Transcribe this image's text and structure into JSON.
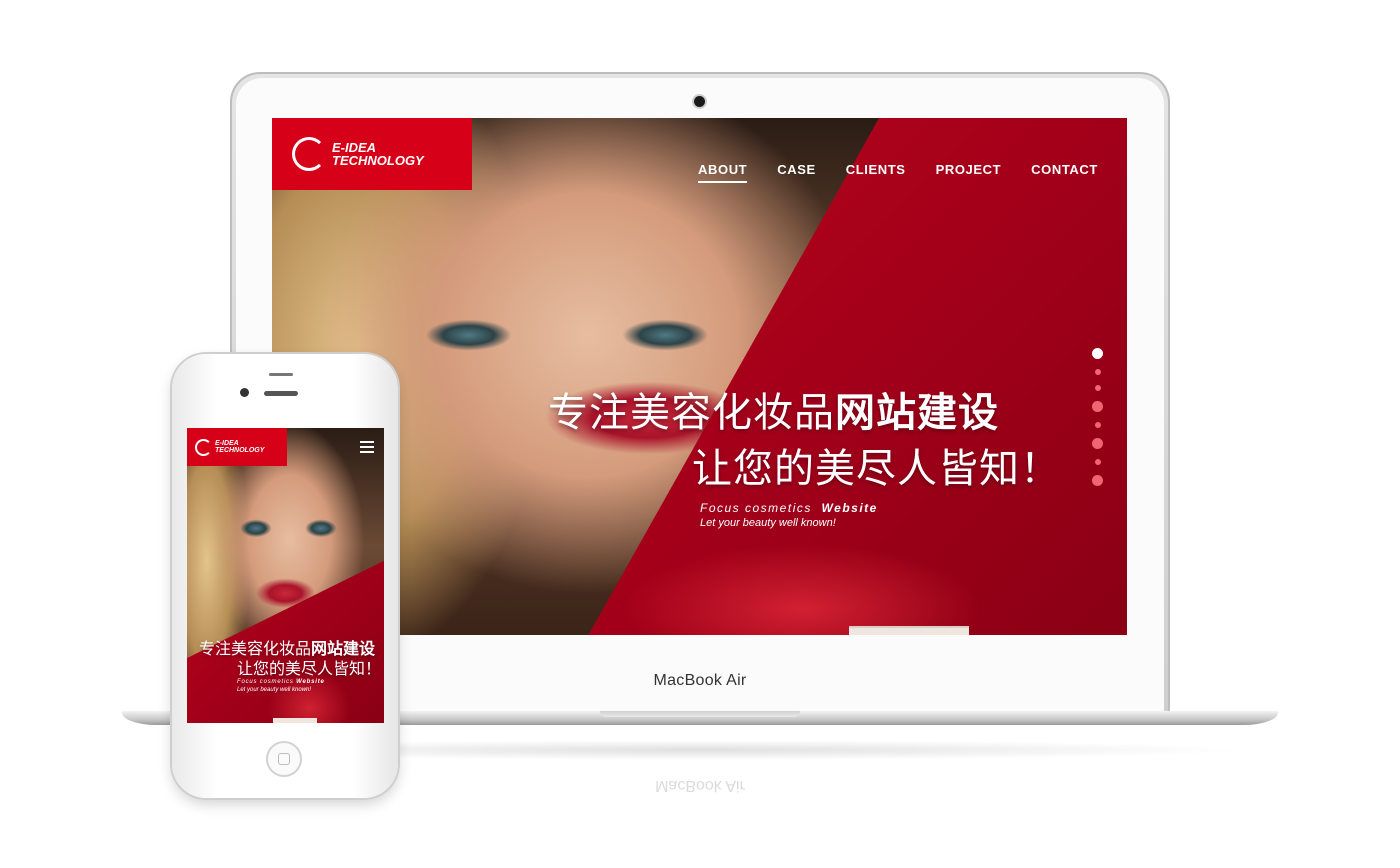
{
  "site": {
    "logo": {
      "line1": "E-IDEA",
      "line2": "TECHNOLOGY"
    },
    "nav": [
      {
        "label": "ABOUT",
        "active": true
      },
      {
        "label": "CASE",
        "active": false
      },
      {
        "label": "CLIENTS",
        "active": false
      },
      {
        "label": "PROJECT",
        "active": false
      },
      {
        "label": "CONTACT",
        "active": false
      }
    ],
    "headline_plain": "专注美容化妆品",
    "headline_bold": "网站建设",
    "headline_line2": "让您的美尽人皆知！",
    "sub_line1_a": "Focus  cosmetics",
    "sub_line1_b": "Website",
    "sub_line2": "Let your beauty well known!",
    "slider_dots": 8,
    "slider_active_index": 0
  },
  "device": {
    "laptop_brand": "MacBook Air"
  },
  "colors": {
    "brand_red": "#d60019",
    "background": "#ffffff"
  },
  "icons": {
    "menu": "hamburger-menu-icon",
    "logo": "swirl-logo-icon"
  }
}
